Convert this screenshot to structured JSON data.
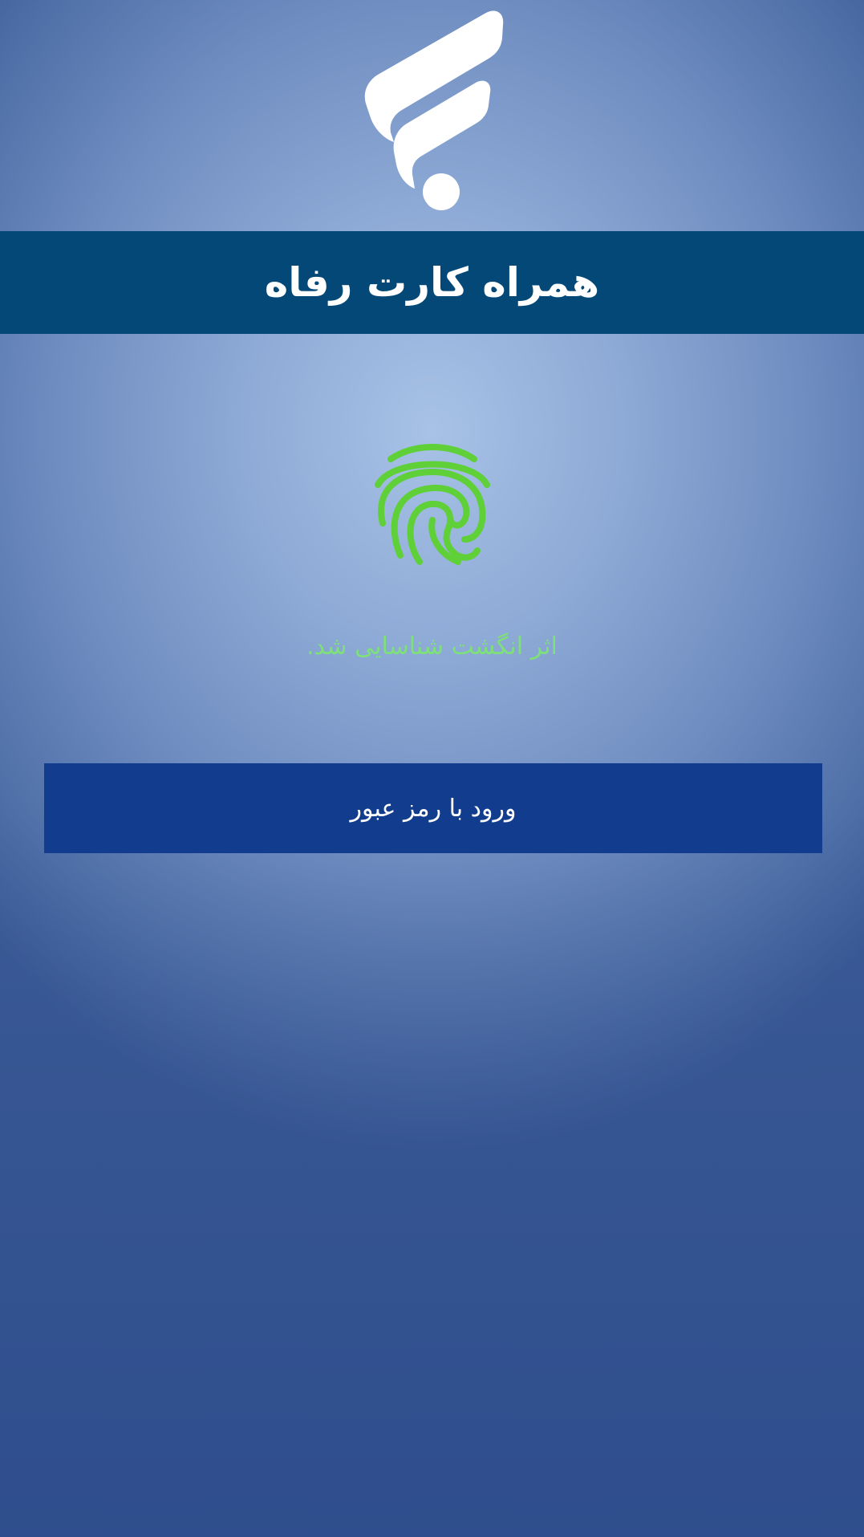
{
  "app": {
    "title": "همراه کارت رفاه",
    "logo_icon": "refah-logo-icon"
  },
  "auth": {
    "fingerprint_icon": "fingerprint-icon",
    "status_message": "اثر انگشت شناسایی شد.",
    "status_color": "#7ee07a",
    "password_login_label": "ورود با رمز عبور"
  },
  "colors": {
    "banner": "#034877",
    "button": "#123d8e",
    "fingerprint": "#5fd038",
    "logo": "#ffffff"
  }
}
